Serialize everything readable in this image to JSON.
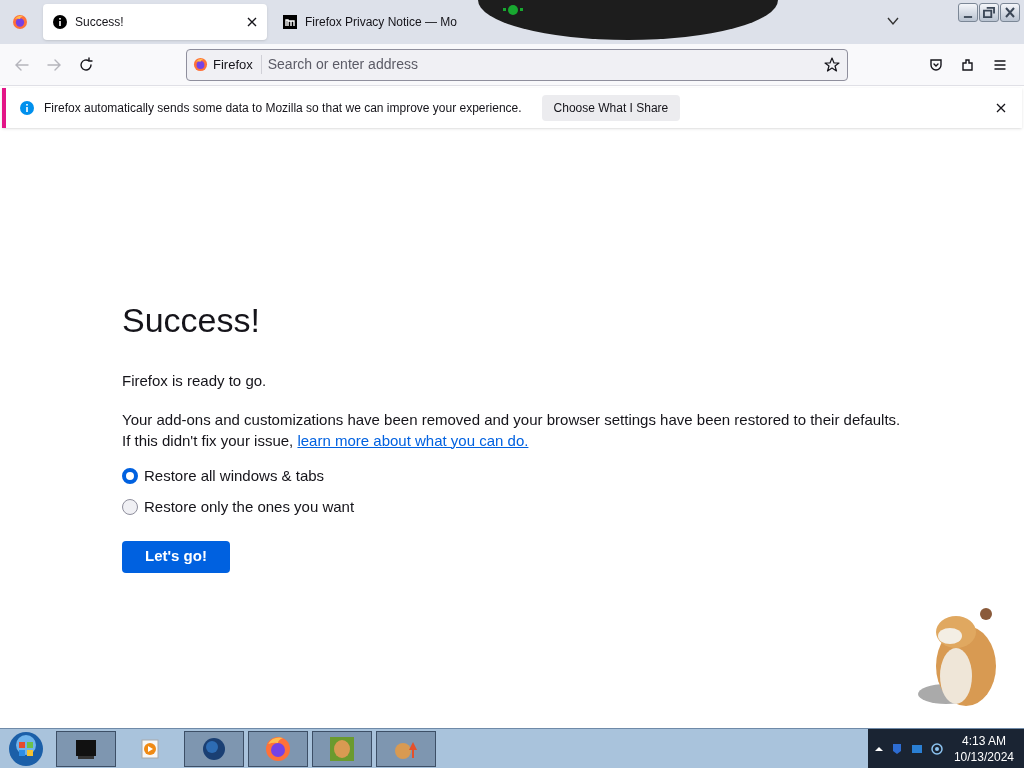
{
  "tabs": [
    {
      "title": "Success!",
      "selected": true
    },
    {
      "title": "Firefox Privacy Notice — Mo",
      "selected": false
    }
  ],
  "toolbar": {
    "identity": "Firefox",
    "placeholder": "Search or enter address"
  },
  "notification": {
    "message": "Firefox automatically sends some data to Mozilla so that we can improve your experience.",
    "button": "Choose What I Share"
  },
  "page": {
    "heading": "Success!",
    "lead": "Firefox is ready to go.",
    "paragraph": "Your add-ons and customizations have been removed and your browser settings have been restored to their defaults.",
    "paragraph_2": "If this didn't fix your issue, ",
    "link": "learn more about what you can do.",
    "options": [
      {
        "label": "Restore all windows & tabs",
        "selected": true
      },
      {
        "label": "Restore only the ones you want",
        "selected": false
      }
    ],
    "button": "Let's go!"
  },
  "taskbar": {
    "apps": [
      {
        "kind": "monitor"
      },
      {
        "kind": "player"
      },
      {
        "kind": "globe"
      },
      {
        "kind": "firefox"
      },
      {
        "kind": "game"
      },
      {
        "kind": "setup"
      }
    ],
    "time": "4:13 AM",
    "date": "10/13/2024"
  }
}
